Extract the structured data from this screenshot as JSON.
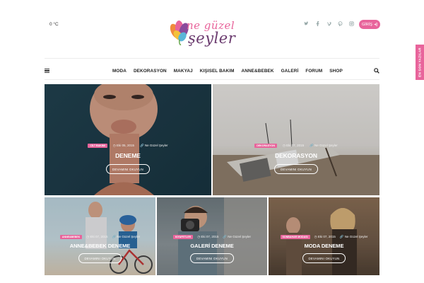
{
  "header": {
    "weather": "0 °C",
    "logo": {
      "line1": "ne güzel",
      "line2": "şeyler"
    },
    "social_icons": [
      "twitter-icon",
      "facebook-icon",
      "vimeo-icon",
      "pinterest-icon",
      "instagram-icon"
    ],
    "login_label": "GİRİŞ",
    "side_tab_label": "EN SON YAZILAR"
  },
  "nav": {
    "menu": [
      "MODA",
      "DEKORASYON",
      "MAKYAJ",
      "KIŞISEL BAKIM",
      "ANNE&BEBEK",
      "GALERİ",
      "FORUM",
      "SHOP"
    ]
  },
  "posts": [
    {
      "tag": "CİLT BAKIMI",
      "date": "Eki 05, 2015",
      "author": "Ne Güzel Şeyler",
      "title": "DENEME",
      "button": "DEVAMINI OKUYUN"
    },
    {
      "tag": "DEKORASYON",
      "date": "Eki 07, 2015",
      "author": "Ne Güzel Şeyler",
      "title": "DEKORASYON",
      "button": "DEVAMINI OKUYUN"
    },
    {
      "tag": "ANNE&BEBEK",
      "date": "Eki 07, 2015",
      "author": "Ne Güzel Şeyler",
      "title": "ANNE&BEBEK DENEME",
      "button": "DEVAMINI OKUYUN"
    },
    {
      "tag": "KIYAFETLER",
      "date": "Eki 07, 2015",
      "author": "Ne Güzel Şeyler",
      "title": "GALERİ DENEME",
      "button": "DEVAMINI OKUYUN"
    },
    {
      "tag": "SONBAHAR MODASI",
      "date": "Eki 07, 2015",
      "author": "Ne Güzel Şeyler",
      "title": "MODA DENEME",
      "button": "DEVAMINI OKUYUN"
    }
  ],
  "colors": {
    "accent": "#e8649b",
    "logo_dark": "#6a3a6e"
  }
}
